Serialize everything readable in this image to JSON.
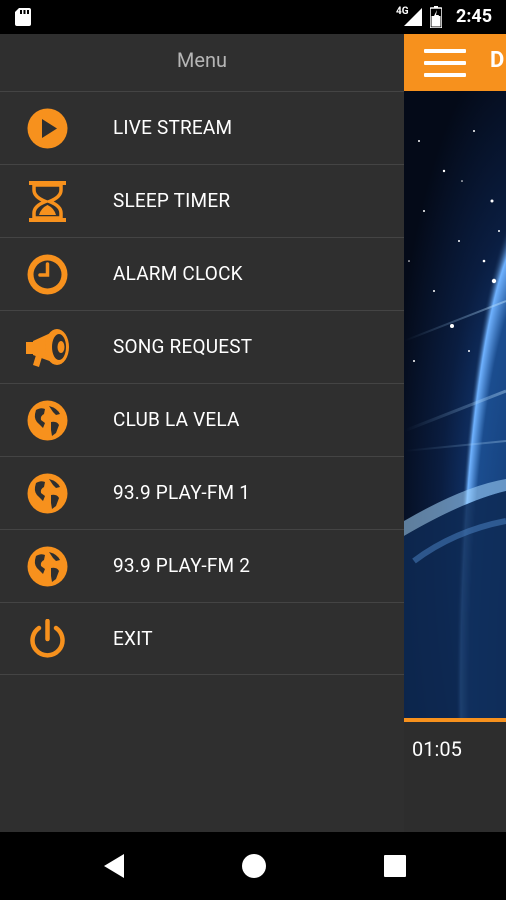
{
  "status_bar": {
    "network": "4G",
    "time": "2:45"
  },
  "app": {
    "title_partial": "D",
    "elapsed_time": "01:05"
  },
  "drawer": {
    "title": "Menu",
    "items": [
      {
        "label": "LIVE STREAM",
        "icon": "play-icon"
      },
      {
        "label": "SLEEP TIMER",
        "icon": "hourglass-icon"
      },
      {
        "label": "ALARM CLOCK",
        "icon": "clock-icon"
      },
      {
        "label": "SONG REQUEST",
        "icon": "megaphone-icon"
      },
      {
        "label": "CLUB LA VELA",
        "icon": "globe-icon"
      },
      {
        "label": "93.9 PLAY-FM 1",
        "icon": "globe-icon"
      },
      {
        "label": "93.9 PLAY-FM 2",
        "icon": "globe-icon"
      },
      {
        "label": "EXIT",
        "icon": "power-icon"
      }
    ]
  },
  "colors": {
    "accent": "#f7911d",
    "drawer_bg": "#2f2f2f",
    "divider": "#444444"
  }
}
